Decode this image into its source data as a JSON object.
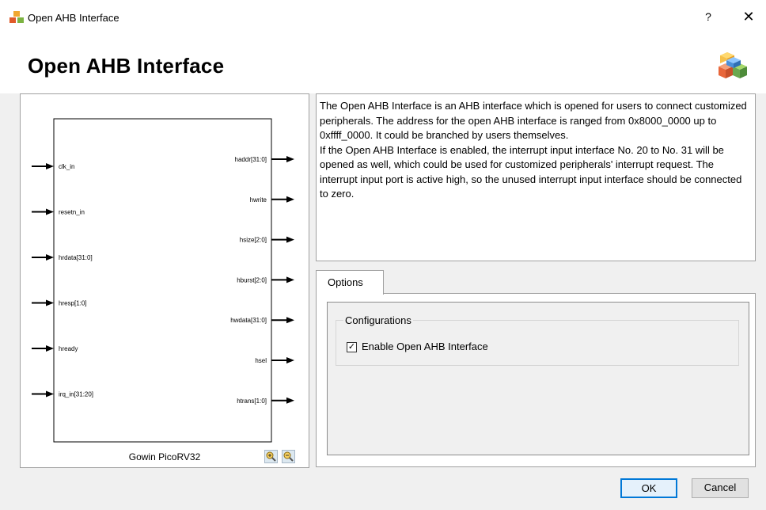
{
  "window": {
    "title": "Open AHB Interface",
    "help_glyph": "?",
    "close_glyph": "✕"
  },
  "header": {
    "title": "Open AHB Interface",
    "logo_icon": "cubes-icon"
  },
  "diagram": {
    "core_name": "Gowin PicoRV32",
    "inputs": [
      "clk_in",
      "resetn_in",
      "hrdata[31:0]",
      "hresp[1:0]",
      "hready",
      "irq_in[31:20]"
    ],
    "outputs": [
      "haddr[31:0]",
      "hwrite",
      "hsize[2:0]",
      "hburst[2:0]",
      "hwdata[31:0]",
      "hsel",
      "htrans[1:0]"
    ],
    "zoom_in_icon": "zoom-in-icon",
    "zoom_out_icon": "zoom-out-icon"
  },
  "description": {
    "paragraph1": "The Open AHB Interface is an AHB interface which is opened for users to connect customized peripherals. The address for the open AHB interface is ranged from 0x8000_0000 up to 0xffff_0000. It could be branched by users themselves.",
    "paragraph2": "If the Open AHB Interface is enabled, the interrupt input interface No. 20 to No. 31 will be opened as well, which could be used for customized peripherals' interrupt request. The interrupt input port is active high, so the unused interrupt input interface should be connected to zero."
  },
  "options": {
    "tab_label": "Options",
    "group_title": "Configurations",
    "checkbox_label": "Enable Open AHB Interface",
    "checkbox_checked": true,
    "check_glyph": "✓"
  },
  "buttons": {
    "ok": "OK",
    "cancel": "Cancel"
  },
  "colors": {
    "accent": "#0078d7"
  }
}
